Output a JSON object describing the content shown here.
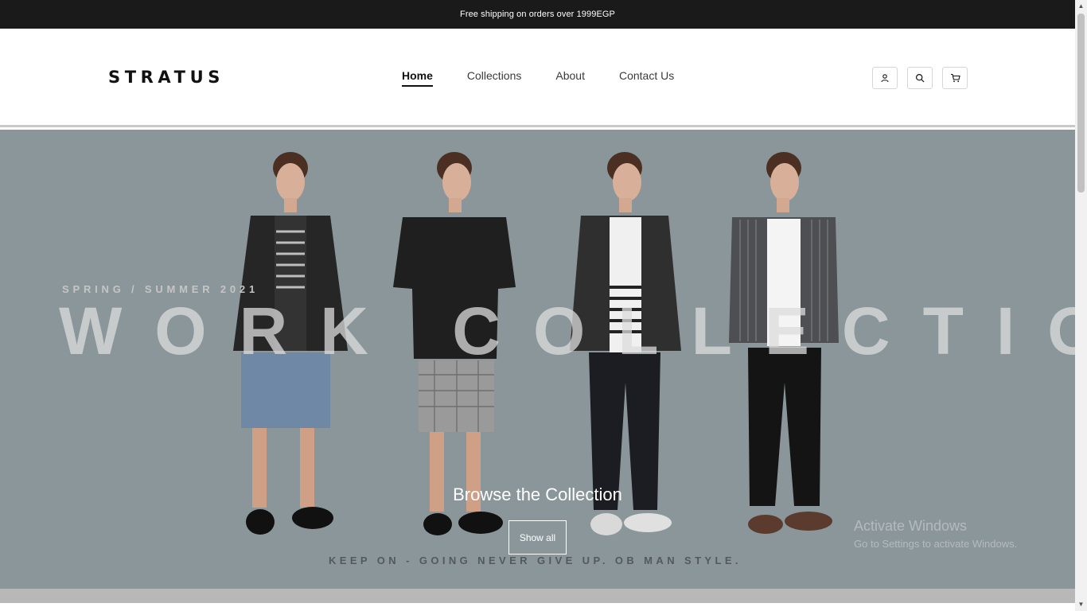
{
  "announcement": {
    "text": "Free shipping on orders over 1999EGP"
  },
  "header": {
    "logo": "STRATUS",
    "nav": [
      {
        "label": "Home",
        "active": true
      },
      {
        "label": "Collections",
        "active": false
      },
      {
        "label": "About",
        "active": false
      },
      {
        "label": "Contact Us",
        "active": false
      }
    ],
    "icons": [
      "account-icon",
      "search-icon",
      "cart-icon"
    ]
  },
  "hero": {
    "subtitle": "SPRING / SUMMER 2021",
    "title": "WORK COLLECTION",
    "tagline": "KEEP ON - GOING NEVER GIVE UP.   OB MAN STYLE.",
    "heading": "Browse the Collection",
    "button_label": "Show all",
    "background_color": "#8b969b"
  },
  "watermark": {
    "line1": "Activate Windows",
    "line2": "Go to Settings to activate Windows."
  },
  "colors": {
    "announcement_bg": "#1a1a1a",
    "text_dark": "#111111"
  }
}
